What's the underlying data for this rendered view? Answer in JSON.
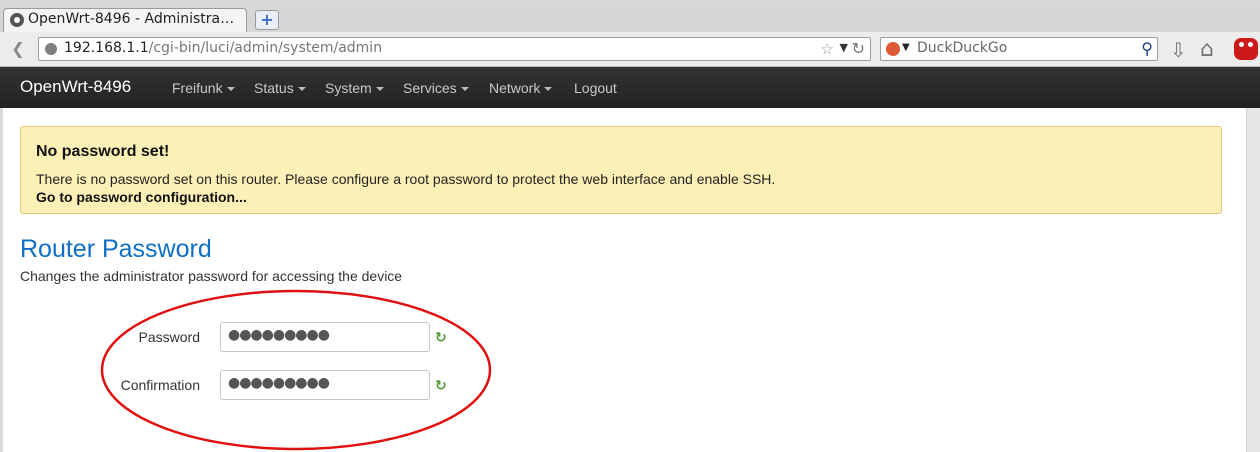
{
  "browser": {
    "tab_title": "OpenWrt-8496 - Administra…",
    "new_tab_label": "+",
    "url_host": "192.168.1.1",
    "url_path": "/cgi-bin/luci/admin/system/admin",
    "search_placeholder": "DuckDuckGo",
    "icons": [
      "back-icon",
      "globe-icon",
      "bookmark-star-icon",
      "reload-icon",
      "duckduckgo-icon",
      "search-icon",
      "download-icon",
      "home-icon",
      "addon-icon"
    ]
  },
  "luci": {
    "brand": "OpenWrt-8496",
    "menu": [
      "Freifunk",
      "Status",
      "System",
      "Services",
      "Network",
      "Logout"
    ]
  },
  "alert": {
    "title": "No password set!",
    "text": "There is no password set on this router. Please configure a root password to protect the web interface and enable SSH.",
    "link": "Go to password configuration..."
  },
  "page": {
    "heading": "Router Password",
    "description": "Changes the administrator password for accessing the device"
  },
  "form": {
    "password_label": "Password",
    "password_value": "●●●●●●●●●",
    "confirmation_label": "Confirmation",
    "confirmation_value": "●●●●●●●●●",
    "reveal_icon": "refresh-icon"
  },
  "colors": {
    "annotation": "#e01010",
    "heading": "#0f6fc6",
    "alert_bg": "#fcf0b6"
  }
}
